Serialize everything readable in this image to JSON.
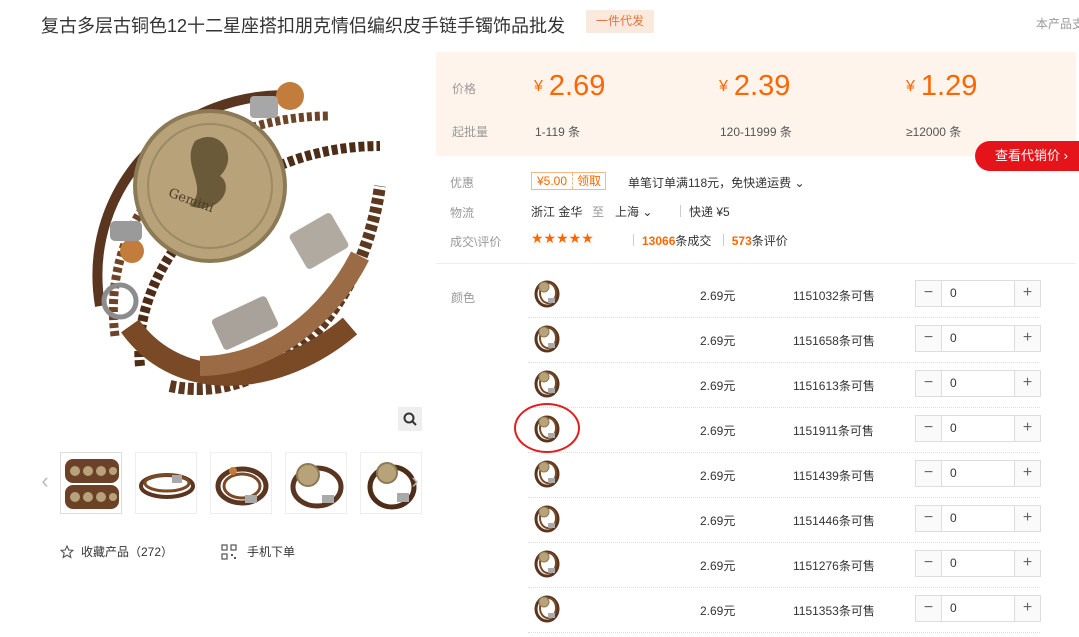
{
  "header": {
    "title": "复古多层古铜色12十二星座搭扣朋克情侣编织皮手链手镯饰品批发",
    "agent_tag": "一件代发",
    "right_text": "本产品支"
  },
  "gallery": {
    "medallion_text": "Gemini",
    "favorite_label": "收藏产品（272）",
    "mobile_label": "手机下单"
  },
  "pricing": {
    "price_label": "价格",
    "qty_label": "起批量",
    "currency": "¥",
    "tiers": [
      {
        "price": "2.69",
        "range": "1-119 条"
      },
      {
        "price": "2.39",
        "range": "120-11999 条"
      },
      {
        "price": "1.29",
        "range": "≥12000 条"
      }
    ],
    "agent_price_button": "查看代销价 ›"
  },
  "info": {
    "promo_label": "优惠",
    "coupon_amount": "¥5.00",
    "coupon_claim": "领取",
    "promo_text": "单笔订单满118元，免快递运费 ⌄",
    "logistics_label": "物流",
    "origin": "浙江 金华",
    "to_label": "至",
    "destination": "上海  ⌄",
    "shipping": "快递 ¥5",
    "deals_label": "成交\\评价",
    "stars": "★★★★★",
    "deals_count": "13066",
    "deals_suffix": "条成交",
    "reviews_count": "573",
    "reviews_suffix": "条评价"
  },
  "sku": {
    "label": "颜色",
    "rows": [
      {
        "price": "2.69元",
        "stock": "1151032条可售",
        "qty": "0"
      },
      {
        "price": "2.69元",
        "stock": "1151658条可售",
        "qty": "0"
      },
      {
        "price": "2.69元",
        "stock": "1151613条可售",
        "qty": "0"
      },
      {
        "price": "2.69元",
        "stock": "1151911条可售",
        "qty": "0"
      },
      {
        "price": "2.69元",
        "stock": "1151439条可售",
        "qty": "0"
      },
      {
        "price": "2.69元",
        "stock": "1151446条可售",
        "qty": "0"
      },
      {
        "price": "2.69元",
        "stock": "1151276条可售",
        "qty": "0"
      },
      {
        "price": "2.69元",
        "stock": "1151353条可售",
        "qty": "0"
      }
    ],
    "minus": "−",
    "plus": "+"
  },
  "colors": {
    "accent": "#ff6600",
    "red_button": "#e4141a",
    "price_bg": "#fef4ec"
  }
}
